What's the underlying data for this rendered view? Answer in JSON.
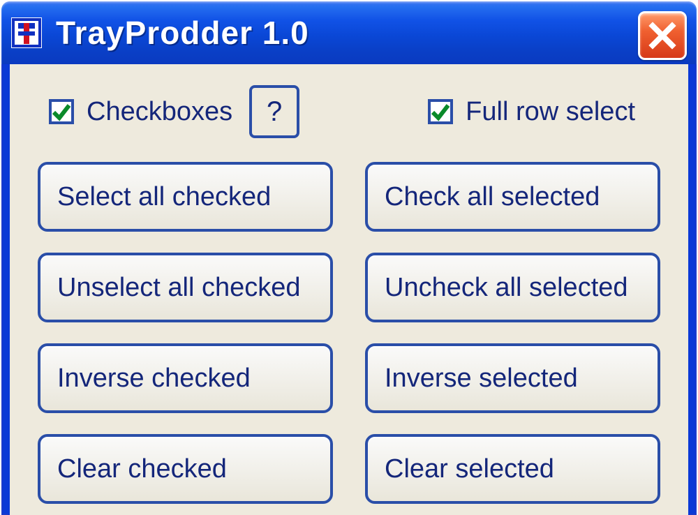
{
  "window": {
    "title": "TrayProdder 1.0"
  },
  "options": {
    "checkboxes_label": "Checkboxes",
    "checkboxes_checked": true,
    "fullrow_label": "Full row select",
    "fullrow_checked": true,
    "help_label": "?"
  },
  "buttons": {
    "left": [
      "Select all checked",
      "Unselect all checked",
      "Inverse checked",
      "Clear checked"
    ],
    "right": [
      "Check all selected",
      "Uncheck all selected",
      "Inverse selected",
      "Clear selected"
    ]
  }
}
